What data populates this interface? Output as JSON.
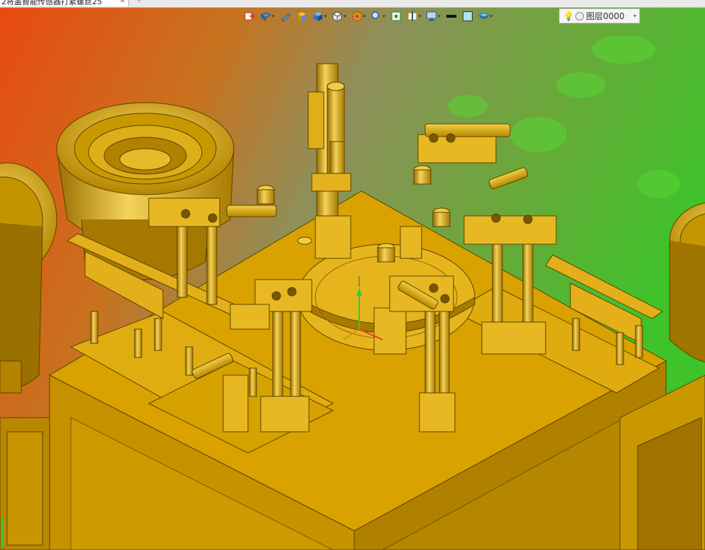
{
  "tab": {
    "title": "2将盖智能传感器打紧螺丝25",
    "close": "✕",
    "overflow": "+"
  },
  "toolbar": {
    "tools": [
      {
        "name": "exit-sketch-icon",
        "has_dropdown": false
      },
      {
        "name": "view-orient-icon",
        "has_dropdown": true
      },
      {
        "name": "pen-tool-icon",
        "has_dropdown": false
      },
      {
        "name": "shaded-cube-icon",
        "has_dropdown": false
      },
      {
        "name": "display-style-icon",
        "has_dropdown": true
      },
      {
        "name": "wireframe-cube-icon",
        "has_dropdown": true
      },
      {
        "name": "render-wheel-icon",
        "has_dropdown": true
      },
      {
        "name": "zoom-icon",
        "has_dropdown": true
      },
      {
        "name": "zoom-fit-icon",
        "has_dropdown": false
      },
      {
        "name": "section-view-icon",
        "has_dropdown": true
      },
      {
        "name": "monitor-icon",
        "has_dropdown": true
      },
      {
        "name": "line-style-icon",
        "has_dropdown": false
      },
      {
        "name": "color-swatch-icon",
        "has_dropdown": false
      },
      {
        "name": "layers-icon",
        "has_dropdown": true
      }
    ],
    "caret": "▾"
  },
  "layer": {
    "bulb": "💡",
    "name": "图层0000",
    "dropdown": "▾"
  },
  "colors": {
    "bg_red": "#e84a10",
    "bg_green": "#3fc22a",
    "gold": "#d6a100",
    "gold_light": "#f1c93a",
    "gold_dark": "#8a6400"
  }
}
